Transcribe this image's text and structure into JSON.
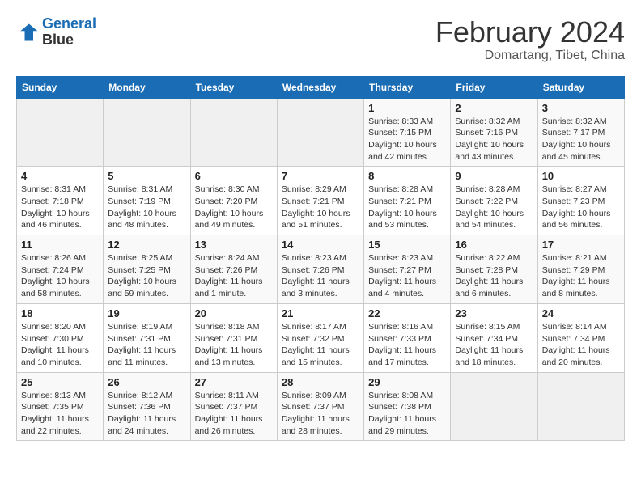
{
  "header": {
    "logo_line1": "General",
    "logo_line2": "Blue",
    "month": "February 2024",
    "location": "Domartang, Tibet, China"
  },
  "weekdays": [
    "Sunday",
    "Monday",
    "Tuesday",
    "Wednesday",
    "Thursday",
    "Friday",
    "Saturday"
  ],
  "weeks": [
    [
      {
        "day": "",
        "info": ""
      },
      {
        "day": "",
        "info": ""
      },
      {
        "day": "",
        "info": ""
      },
      {
        "day": "",
        "info": ""
      },
      {
        "day": "1",
        "info": "Sunrise: 8:33 AM\nSunset: 7:15 PM\nDaylight: 10 hours\nand 42 minutes."
      },
      {
        "day": "2",
        "info": "Sunrise: 8:32 AM\nSunset: 7:16 PM\nDaylight: 10 hours\nand 43 minutes."
      },
      {
        "day": "3",
        "info": "Sunrise: 8:32 AM\nSunset: 7:17 PM\nDaylight: 10 hours\nand 45 minutes."
      }
    ],
    [
      {
        "day": "4",
        "info": "Sunrise: 8:31 AM\nSunset: 7:18 PM\nDaylight: 10 hours\nand 46 minutes."
      },
      {
        "day": "5",
        "info": "Sunrise: 8:31 AM\nSunset: 7:19 PM\nDaylight: 10 hours\nand 48 minutes."
      },
      {
        "day": "6",
        "info": "Sunrise: 8:30 AM\nSunset: 7:20 PM\nDaylight: 10 hours\nand 49 minutes."
      },
      {
        "day": "7",
        "info": "Sunrise: 8:29 AM\nSunset: 7:21 PM\nDaylight: 10 hours\nand 51 minutes."
      },
      {
        "day": "8",
        "info": "Sunrise: 8:28 AM\nSunset: 7:21 PM\nDaylight: 10 hours\nand 53 minutes."
      },
      {
        "day": "9",
        "info": "Sunrise: 8:28 AM\nSunset: 7:22 PM\nDaylight: 10 hours\nand 54 minutes."
      },
      {
        "day": "10",
        "info": "Sunrise: 8:27 AM\nSunset: 7:23 PM\nDaylight: 10 hours\nand 56 minutes."
      }
    ],
    [
      {
        "day": "11",
        "info": "Sunrise: 8:26 AM\nSunset: 7:24 PM\nDaylight: 10 hours\nand 58 minutes."
      },
      {
        "day": "12",
        "info": "Sunrise: 8:25 AM\nSunset: 7:25 PM\nDaylight: 10 hours\nand 59 minutes."
      },
      {
        "day": "13",
        "info": "Sunrise: 8:24 AM\nSunset: 7:26 PM\nDaylight: 11 hours\nand 1 minute."
      },
      {
        "day": "14",
        "info": "Sunrise: 8:23 AM\nSunset: 7:26 PM\nDaylight: 11 hours\nand 3 minutes."
      },
      {
        "day": "15",
        "info": "Sunrise: 8:23 AM\nSunset: 7:27 PM\nDaylight: 11 hours\nand 4 minutes."
      },
      {
        "day": "16",
        "info": "Sunrise: 8:22 AM\nSunset: 7:28 PM\nDaylight: 11 hours\nand 6 minutes."
      },
      {
        "day": "17",
        "info": "Sunrise: 8:21 AM\nSunset: 7:29 PM\nDaylight: 11 hours\nand 8 minutes."
      }
    ],
    [
      {
        "day": "18",
        "info": "Sunrise: 8:20 AM\nSunset: 7:30 PM\nDaylight: 11 hours\nand 10 minutes."
      },
      {
        "day": "19",
        "info": "Sunrise: 8:19 AM\nSunset: 7:31 PM\nDaylight: 11 hours\nand 11 minutes."
      },
      {
        "day": "20",
        "info": "Sunrise: 8:18 AM\nSunset: 7:31 PM\nDaylight: 11 hours\nand 13 minutes."
      },
      {
        "day": "21",
        "info": "Sunrise: 8:17 AM\nSunset: 7:32 PM\nDaylight: 11 hours\nand 15 minutes."
      },
      {
        "day": "22",
        "info": "Sunrise: 8:16 AM\nSunset: 7:33 PM\nDaylight: 11 hours\nand 17 minutes."
      },
      {
        "day": "23",
        "info": "Sunrise: 8:15 AM\nSunset: 7:34 PM\nDaylight: 11 hours\nand 18 minutes."
      },
      {
        "day": "24",
        "info": "Sunrise: 8:14 AM\nSunset: 7:34 PM\nDaylight: 11 hours\nand 20 minutes."
      }
    ],
    [
      {
        "day": "25",
        "info": "Sunrise: 8:13 AM\nSunset: 7:35 PM\nDaylight: 11 hours\nand 22 minutes."
      },
      {
        "day": "26",
        "info": "Sunrise: 8:12 AM\nSunset: 7:36 PM\nDaylight: 11 hours\nand 24 minutes."
      },
      {
        "day": "27",
        "info": "Sunrise: 8:11 AM\nSunset: 7:37 PM\nDaylight: 11 hours\nand 26 minutes."
      },
      {
        "day": "28",
        "info": "Sunrise: 8:09 AM\nSunset: 7:37 PM\nDaylight: 11 hours\nand 28 minutes."
      },
      {
        "day": "29",
        "info": "Sunrise: 8:08 AM\nSunset: 7:38 PM\nDaylight: 11 hours\nand 29 minutes."
      },
      {
        "day": "",
        "info": ""
      },
      {
        "day": "",
        "info": ""
      }
    ]
  ]
}
